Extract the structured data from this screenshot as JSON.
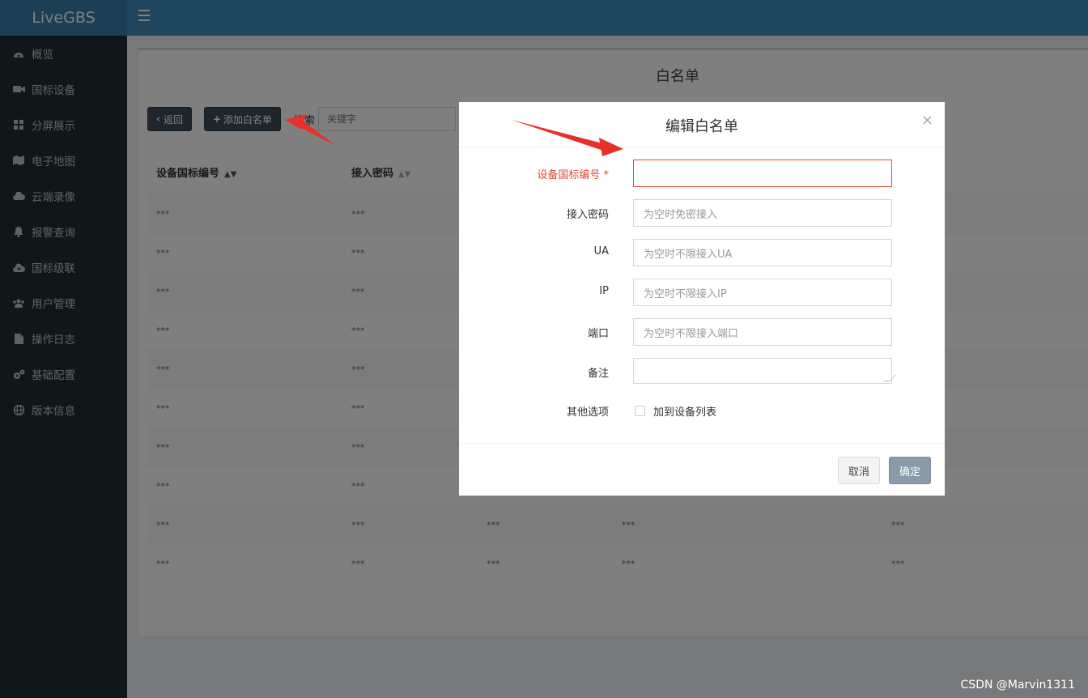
{
  "app": {
    "brand": "LiveGBS"
  },
  "sidebar": {
    "items": [
      {
        "label": "概览",
        "icon": "dashboard-icon"
      },
      {
        "label": "国标设备",
        "icon": "video-camera-icon"
      },
      {
        "label": "分屏展示",
        "icon": "grid-icon"
      },
      {
        "label": "电子地图",
        "icon": "map-icon"
      },
      {
        "label": "云端录像",
        "icon": "cloud-icon"
      },
      {
        "label": "报警查询",
        "icon": "bell-icon"
      },
      {
        "label": "国标级联",
        "icon": "cloud-upload-icon"
      },
      {
        "label": "用户管理",
        "icon": "users-icon"
      },
      {
        "label": "操作日志",
        "icon": "file-icon"
      },
      {
        "label": "基础配置",
        "icon": "gears-icon"
      },
      {
        "label": "版本信息",
        "icon": "globe-icon"
      }
    ]
  },
  "page": {
    "title": "白名单",
    "back_label": "返回",
    "add_label": "添加白名单",
    "search_label": "搜索",
    "search_placeholder": "关键字"
  },
  "table": {
    "columns": [
      "设备国标编号",
      "接入密码"
    ],
    "rows": [
      [
        "***",
        "***",
        "",
        "",
        ""
      ],
      [
        "***",
        "***",
        "",
        "",
        ""
      ],
      [
        "***",
        "***",
        "",
        "",
        ""
      ],
      [
        "***",
        "***",
        "",
        "",
        ""
      ],
      [
        "***",
        "***",
        "",
        "",
        ""
      ],
      [
        "***",
        "***",
        "",
        "",
        ""
      ],
      [
        "***",
        "***",
        "",
        "",
        ""
      ],
      [
        "***",
        "***",
        "",
        "",
        ""
      ],
      [
        "***",
        "***",
        "***",
        "***",
        "***"
      ],
      [
        "***",
        "***",
        "***",
        "***",
        "***"
      ]
    ]
  },
  "modal": {
    "title": "编辑白名单",
    "close": "×",
    "fields": {
      "device_id": {
        "label": "设备国标编号 *",
        "value": ""
      },
      "password": {
        "label": "接入密码",
        "placeholder": "为空时免密接入"
      },
      "ua": {
        "label": "UA",
        "placeholder": "为空时不限接入UA"
      },
      "ip": {
        "label": "IP",
        "placeholder": "为空时不限接入IP"
      },
      "port": {
        "label": "端口",
        "placeholder": "为空时不限接入端口"
      },
      "remark": {
        "label": "备注",
        "value": ""
      },
      "other": {
        "label": "其他选项",
        "checkbox_label": "加到设备列表"
      }
    },
    "cancel_label": "取消",
    "ok_label": "确定"
  },
  "watermark": "CSDN @Marvin1311",
  "colors": {
    "accent": "#3c8dbc",
    "sidebar": "#222d32",
    "error": "#dd4b39",
    "arrow": "#e8302a"
  }
}
